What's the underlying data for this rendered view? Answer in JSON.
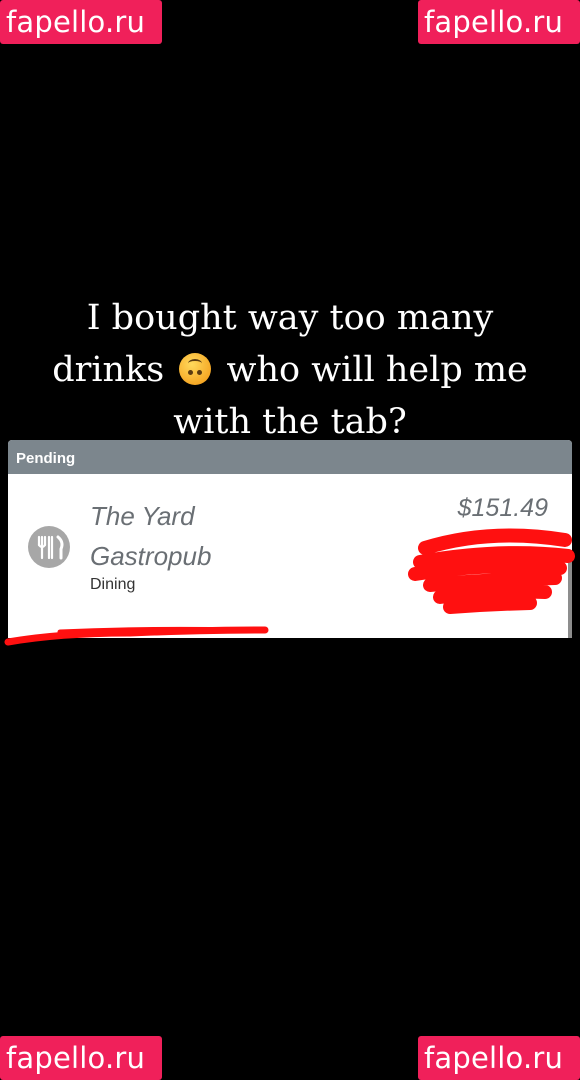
{
  "watermarks": {
    "top_left": "fapello.ru",
    "top_right": "fapello.ru",
    "bottom_left": "fapello.ru",
    "bottom_right": "fapello.ru"
  },
  "caption": {
    "line1": "I bought way too many",
    "line2_before": "drinks",
    "emoji_icon": "upside-down-face-emoji",
    "line2_after": "who will help me",
    "line3": "with the tab?"
  },
  "transaction": {
    "section_label": "Pending",
    "merchant_line1": "The Yard",
    "merchant_line2": "Gastropub",
    "category": "Dining",
    "amount": "$151.49",
    "icon": "fork-knife-icon"
  },
  "colors": {
    "watermark": "#f0205a",
    "redaction": "#ff1010",
    "header": "#7c868d"
  }
}
